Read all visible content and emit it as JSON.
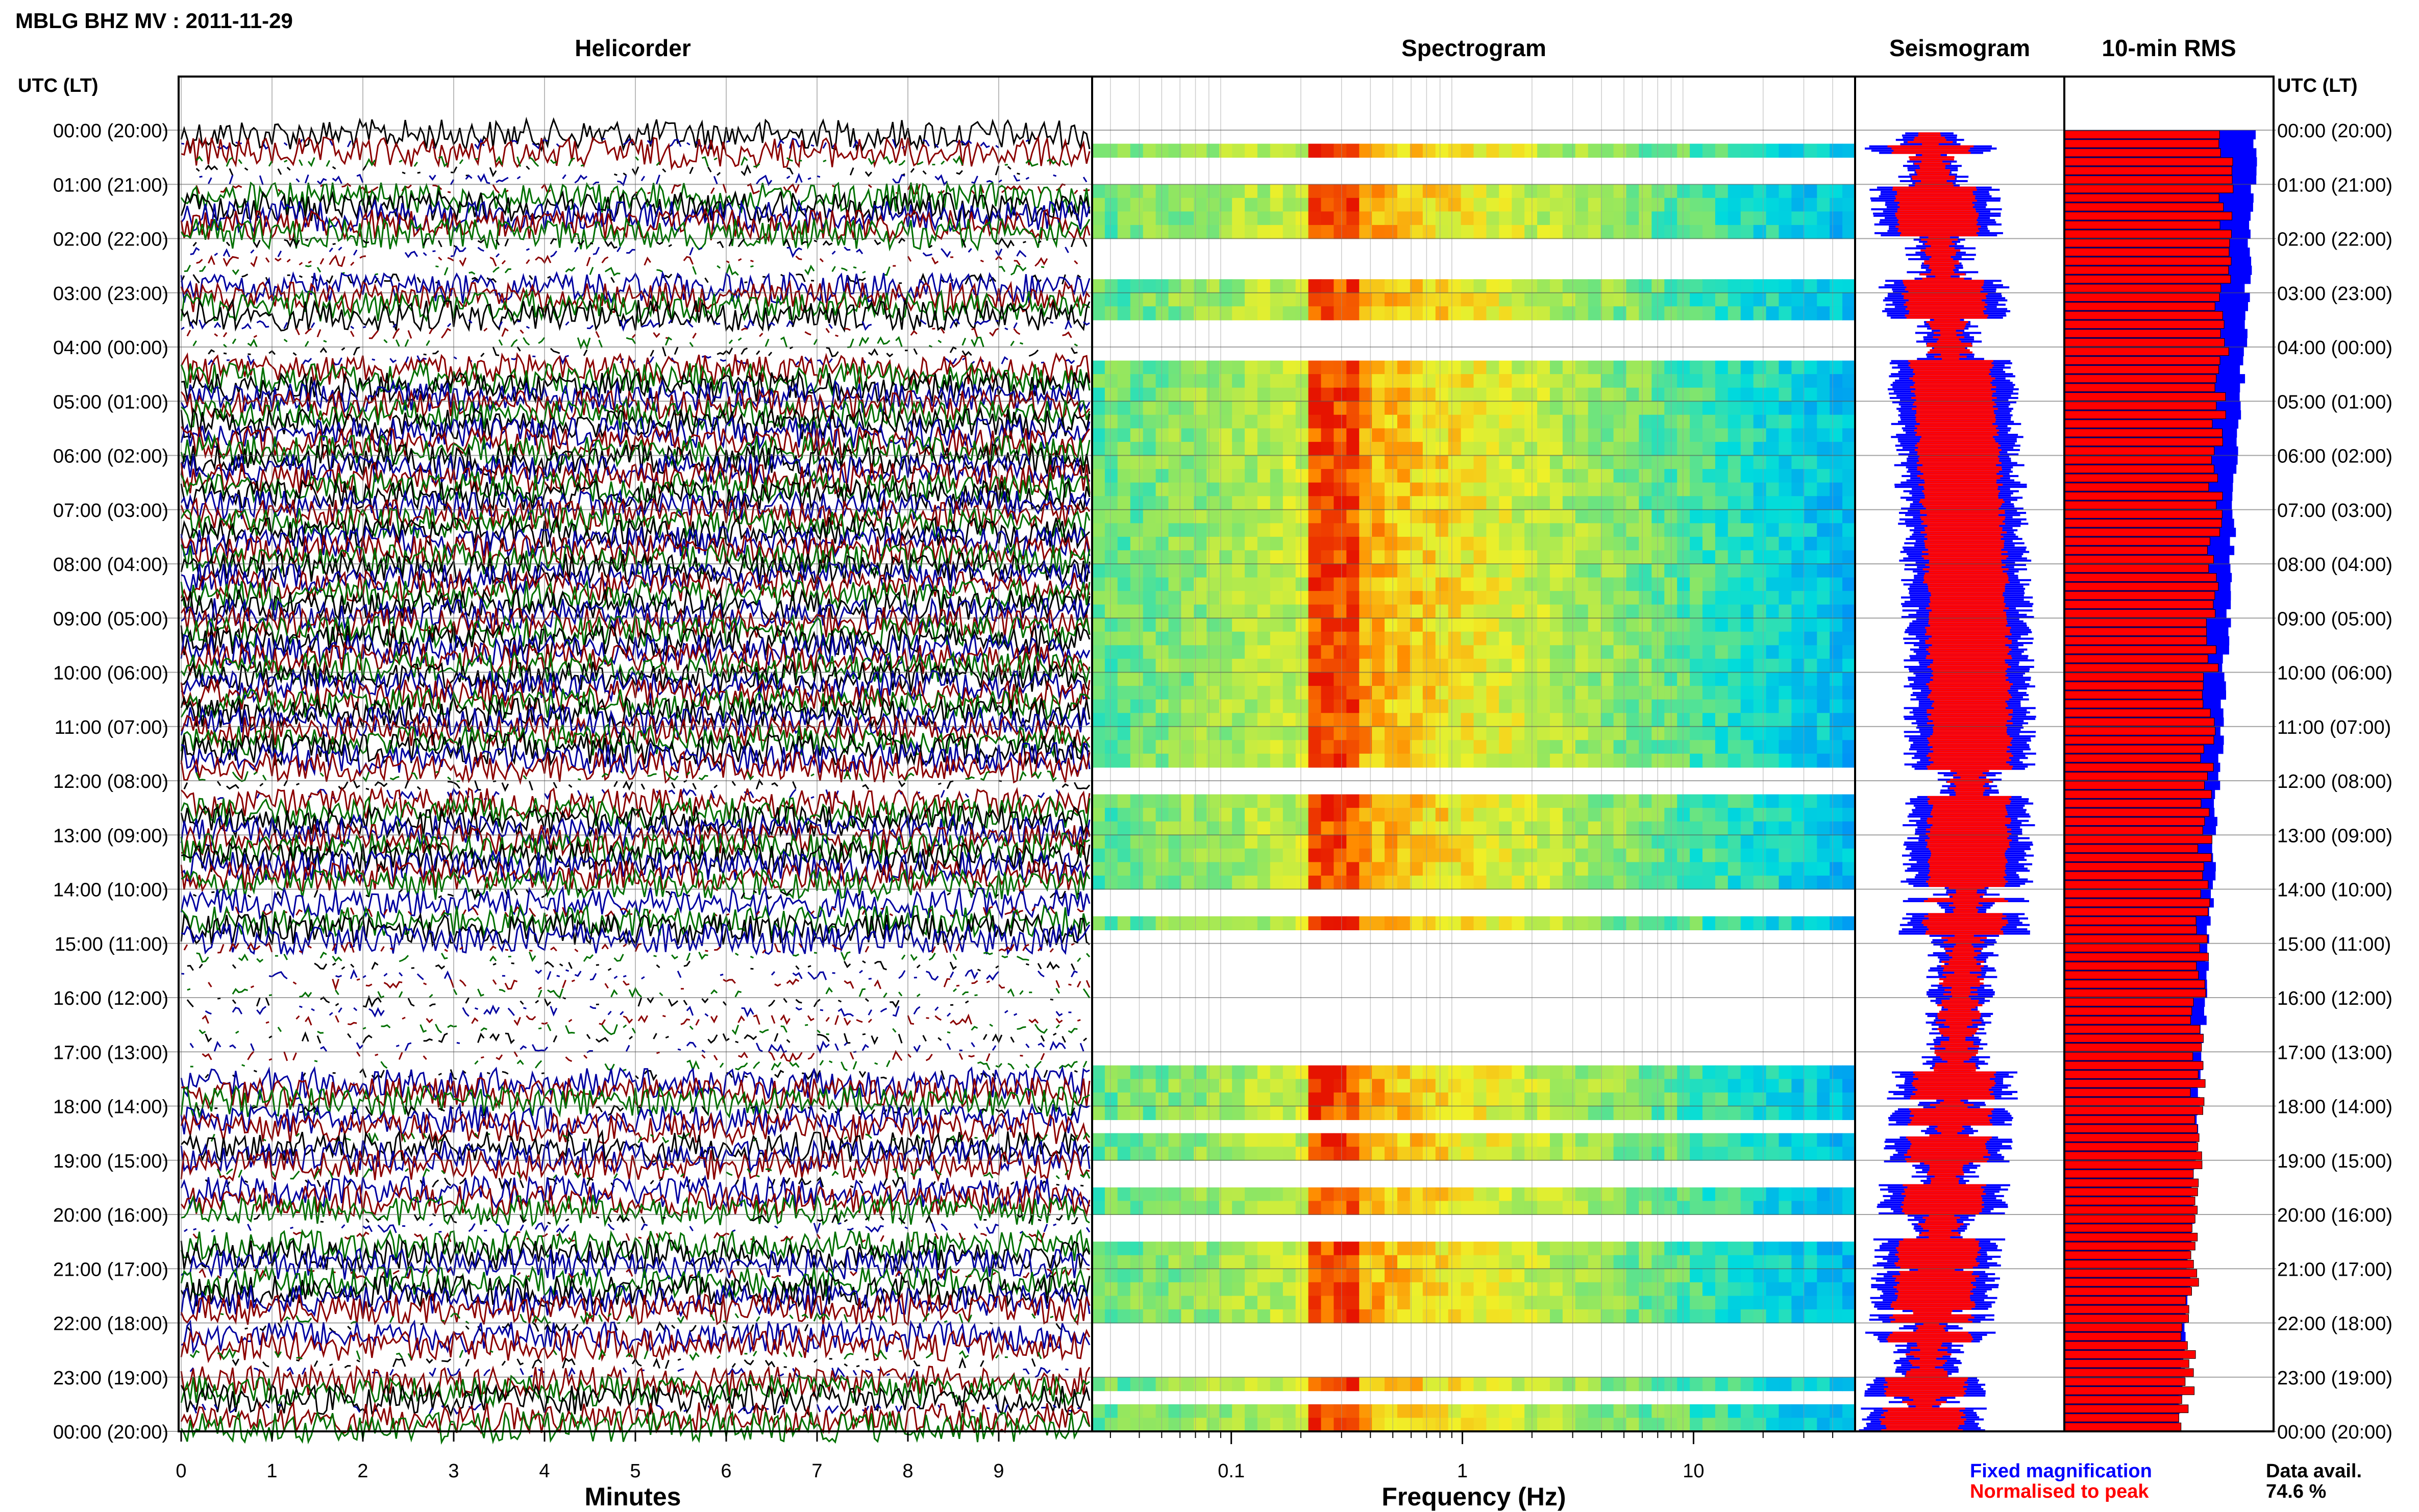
{
  "header": {
    "station_title": "MBLG BHZ MV : 2011-11-29",
    "utc_lt_label": "UTC (LT)"
  },
  "panels": {
    "helicorder_title": "Helicorder",
    "spectrogram_title": "Spectrogram",
    "seismogram_title": "Seismogram",
    "rms_title": "10-min RMS"
  },
  "axes": {
    "minutes_label": "Minutes",
    "frequency_label": "Frequency (Hz)",
    "minute_ticks": [
      "0",
      "1",
      "2",
      "3",
      "4",
      "5",
      "6",
      "7",
      "8",
      "9"
    ],
    "frequency_ticks": [
      "0.1",
      "1",
      "10"
    ]
  },
  "footer": {
    "legend_fixed": "Fixed magnification",
    "legend_normalised": "Normalised to peak",
    "data_avail_label": "Data avail.",
    "data_avail_value": "74.6 %"
  },
  "colors": {
    "fixed": "#0000ff",
    "normalised": "#ff0000",
    "trace_colors": [
      "#000000",
      "#0000a0",
      "#8b0000",
      "#007000"
    ]
  },
  "chart_data": {
    "type": "table",
    "station": "MBLG",
    "channel": "BHZ",
    "network": "MV",
    "date": "2011-11-29",
    "time_labels": [
      "00:00 (20:00)",
      "01:00 (21:00)",
      "02:00 (22:00)",
      "03:00 (23:00)",
      "04:00 (00:00)",
      "05:00 (01:00)",
      "06:00 (02:00)",
      "07:00 (03:00)",
      "08:00 (04:00)",
      "09:00 (05:00)",
      "10:00 (06:00)",
      "11:00 (07:00)",
      "12:00 (08:00)",
      "13:00 (09:00)",
      "14:00 (10:00)",
      "15:00 (11:00)",
      "16:00 (12:00)",
      "17:00 (13:00)",
      "18:00 (14:00)",
      "19:00 (15:00)",
      "20:00 (16:00)",
      "21:00 (17:00)",
      "22:00 (18:00)",
      "23:00 (19:00)",
      "00:00 (20:00)"
    ],
    "helicorder": {
      "xlabel": "Minutes",
      "xlim": [
        0,
        10
      ],
      "rows_per_hour": 6
    },
    "spectrogram": {
      "xlabel": "Frequency (Hz)",
      "xscale": "log",
      "xlim": [
        0.025,
        50
      ],
      "dominant_band_hz": [
        0.2,
        0.35
      ]
    },
    "spectrogram_gaps_hours": [
      [
        0.05,
        0.3
      ],
      [
        0.45,
        1.05
      ],
      [
        1.95,
        2.75
      ],
      [
        3.5,
        4.25
      ],
      [
        11.8,
        12.3
      ],
      [
        13.95,
        14.15
      ],
      [
        14.25,
        14.45
      ],
      [
        14.85,
        17.35
      ],
      [
        17.9,
        18.05
      ],
      [
        18.35,
        18.55
      ],
      [
        19.05,
        19.45
      ],
      [
        20.0,
        20.45
      ],
      [
        21.0,
        21.05
      ],
      [
        21.75,
        21.85
      ],
      [
        22.0,
        22.15
      ],
      [
        22.35,
        23.0
      ],
      [
        23.35,
        23.55
      ]
    ],
    "seismogram": {
      "series": [
        {
          "name": "Fixed magnification",
          "color": "#0000ff"
        },
        {
          "name": "Normalised to peak",
          "color": "#ff0000"
        }
      ]
    },
    "rms_10min": {
      "interval_minutes": 10,
      "fixed_fraction_start": 0.92,
      "fixed_fraction_end": 0.55
    },
    "data_availability_percent": 74.6
  }
}
